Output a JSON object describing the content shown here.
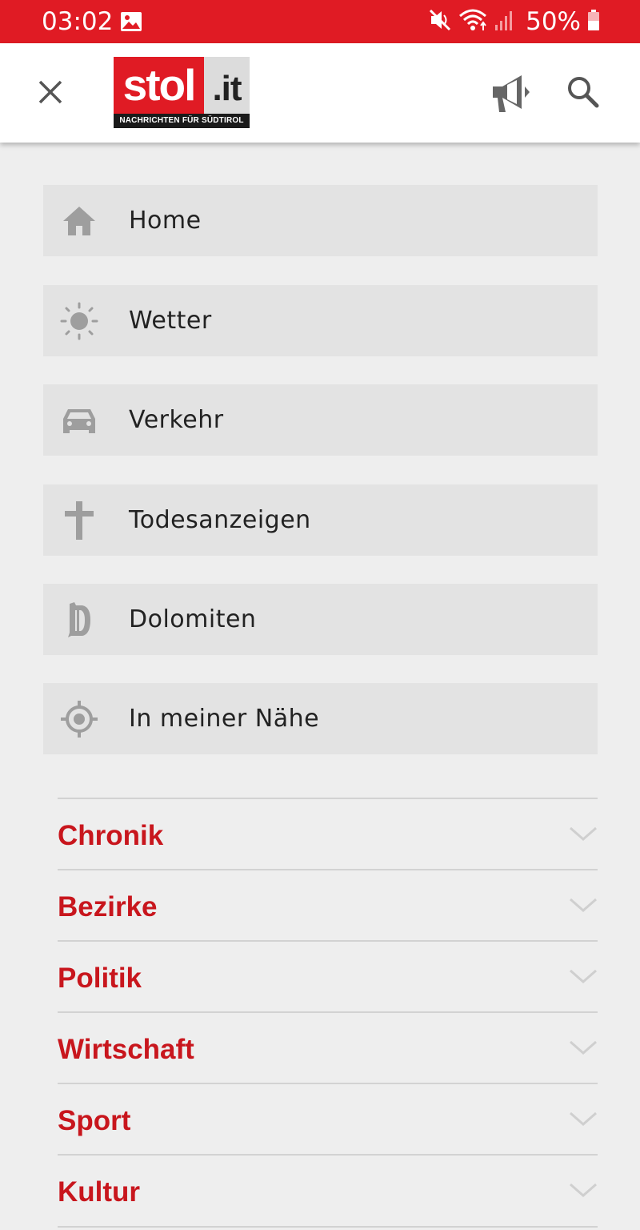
{
  "status_bar": {
    "time": "03:02",
    "battery": "50%",
    "icons": [
      "gallery-icon",
      "mute-icon",
      "wifi-icon",
      "signal-icon",
      "battery-icon"
    ]
  },
  "app_bar": {
    "logo_main": "stol",
    "logo_suffix": ".it",
    "logo_tagline": "NACHRICHTEN FÜR SÜDTIROL",
    "icons": [
      "close-icon",
      "megaphone-icon",
      "search-icon"
    ]
  },
  "quick_menu": [
    {
      "label": "Home",
      "icon": "home-icon"
    },
    {
      "label": "Wetter",
      "icon": "sun-icon"
    },
    {
      "label": "Verkehr",
      "icon": "car-icon"
    },
    {
      "label": "Todesanzeigen",
      "icon": "cross-icon"
    },
    {
      "label": "Dolomiten",
      "icon": "dolomiten-d-icon"
    },
    {
      "label": "In meiner Nähe",
      "icon": "location-target-icon"
    }
  ],
  "sections": [
    {
      "label": "Chronik"
    },
    {
      "label": "Bezirke"
    },
    {
      "label": "Politik"
    },
    {
      "label": "Wirtschaft"
    },
    {
      "label": "Sport"
    },
    {
      "label": "Kultur"
    }
  ],
  "colors": {
    "brand_red": "#e01b24",
    "section_red": "#c8161d",
    "background": "#eeeeee",
    "menu_item_bg": "#e3e3e3",
    "icon_grey": "#9e9e9e"
  }
}
